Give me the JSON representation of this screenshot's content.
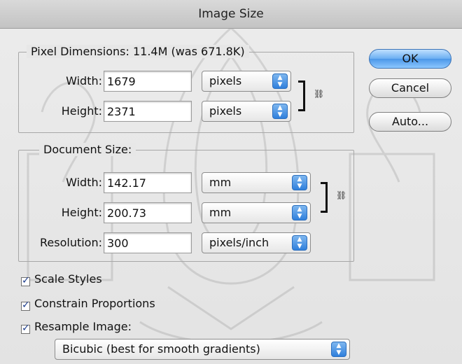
{
  "window": {
    "title": "Image Size"
  },
  "pixel_dimensions": {
    "title": "Pixel Dimensions:  11.4M (was 671.8K)",
    "width_label": "Width:",
    "width_value": "1679",
    "width_unit": "pixels",
    "height_label": "Height:",
    "height_value": "2371",
    "height_unit": "pixels"
  },
  "document_size": {
    "title": "Document Size:",
    "width_label": "Width:",
    "width_value": "142.17",
    "width_unit": "mm",
    "height_label": "Height:",
    "height_value": "200.73",
    "height_unit": "mm",
    "resolution_label": "Resolution:",
    "resolution_value": "300",
    "resolution_unit": "pixels/inch"
  },
  "buttons": {
    "ok": "OK",
    "cancel": "Cancel",
    "auto": "Auto..."
  },
  "options": {
    "scale_styles": {
      "label": "Scale Styles",
      "checked": true
    },
    "constrain_proportions": {
      "label": "Constrain Proportions",
      "checked": true
    },
    "resample_image": {
      "label": "Resample Image:",
      "checked": true
    },
    "resample_method": "Bicubic (best for smooth gradients)"
  },
  "icons": {
    "check": "checkmark-icon",
    "stepper": "stepper-icon",
    "link": "chain-link-icon"
  },
  "colors": {
    "accent": "#4b97e8"
  }
}
